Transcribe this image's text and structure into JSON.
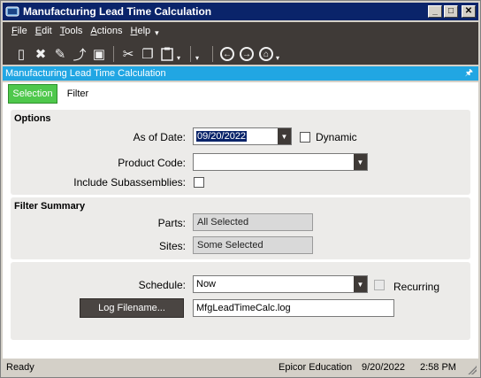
{
  "window": {
    "title": "Manufacturing Lead Time Calculation",
    "buttons": [
      "_",
      "□",
      "✕"
    ]
  },
  "menu": {
    "items": [
      {
        "label": "File",
        "key": "F",
        "rest": "ile"
      },
      {
        "label": "Edit",
        "key": "E",
        "rest": "dit"
      },
      {
        "label": "Tools",
        "key": "T",
        "rest": "ools"
      },
      {
        "label": "Actions",
        "key": "A",
        "rest": "ctions"
      },
      {
        "label": "Help",
        "key": "H",
        "rest": "elp"
      }
    ],
    "more": "▾"
  },
  "toolbar": {
    "icons": [
      "new-icon",
      "delete-icon",
      "clear-icon",
      "attach-icon",
      "print-preview-icon",
      "cut-icon",
      "copy-icon",
      "paste-icon",
      "back-icon",
      "forward-icon",
      "home-icon"
    ],
    "glyphs": {
      "new": "▯",
      "delete": "✖",
      "clear": "✎",
      "attach": "⤴",
      "preview": "▣",
      "cut": "✂",
      "copy": "❐",
      "paste": "📋",
      "back": "←",
      "forward": "→",
      "home": "⌂",
      "drop": "▾"
    }
  },
  "formbar": {
    "title": "Manufacturing Lead Time Calculation",
    "pin": "🖈"
  },
  "tabs": [
    {
      "label": "Selection",
      "active": true
    },
    {
      "label": "Filter",
      "active": false
    }
  ],
  "options": {
    "section_title": "Options",
    "as_of_date_label": "As of Date:",
    "as_of_date_value": "09/20/2022",
    "dynamic_label": "Dynamic",
    "dynamic_checked": false,
    "product_code_label": "Product Code:",
    "product_code_value": "",
    "include_sub_label": "Include Subassemblies:",
    "include_sub_checked": false
  },
  "filter_summary": {
    "section_title": "Filter Summary",
    "parts_label": "Parts:",
    "parts_value": "All Selected",
    "sites_label": "Sites:",
    "sites_value": "Some Selected"
  },
  "schedule": {
    "schedule_label": "Schedule:",
    "schedule_value": "Now",
    "recurring_label": "Recurring",
    "recurring_checked": false,
    "log_button": "Log Filename...",
    "log_value": "MfgLeadTimeCalc.log"
  },
  "status": {
    "state": "Ready",
    "company": "Epicor Education",
    "date": "9/20/2022",
    "time": "2:58 PM"
  },
  "colors": {
    "titlebar": "#0a246a",
    "toolbar": "#3f3a37",
    "formbar": "#21a6e3",
    "active_tab": "#4fc84c",
    "panel": "#ecebe9"
  }
}
